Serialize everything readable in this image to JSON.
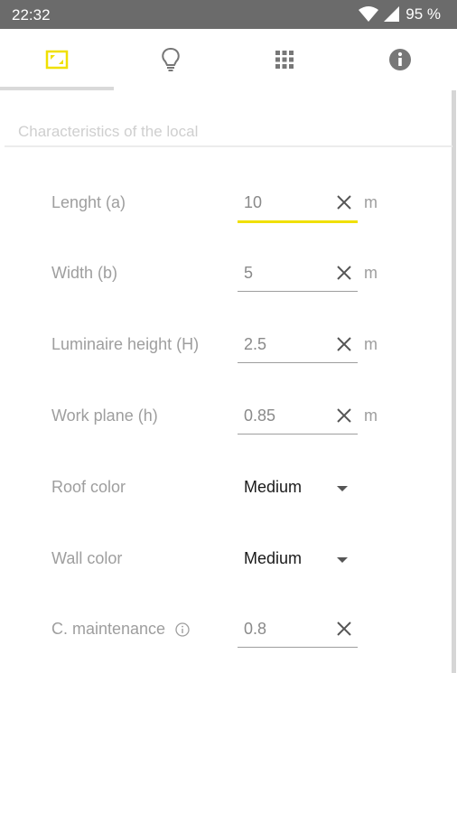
{
  "status_bar": {
    "time": "22:32",
    "battery": "95 %",
    "icons": [
      "wifi-icon",
      "signal-icon",
      "battery-icon"
    ]
  },
  "tabs": [
    {
      "name": "room",
      "icon": "room-dimensions-icon",
      "active": true
    },
    {
      "name": "luminaire",
      "icon": "lightbulb-icon",
      "active": false
    },
    {
      "name": "grid",
      "icon": "grid-icon",
      "active": false
    },
    {
      "name": "info",
      "icon": "info-icon",
      "active": false
    }
  ],
  "section": {
    "title": "Characteristics of the local"
  },
  "form": {
    "length": {
      "label": "Lenght (a)",
      "value": "10",
      "unit": "m"
    },
    "width": {
      "label": "Width (b)",
      "value": "5",
      "unit": "m"
    },
    "luminaire_height": {
      "label": "Luminaire height (H)",
      "value": "2.5",
      "unit": "m"
    },
    "work_plane": {
      "label": "Work plane (h)",
      "value": "0.85",
      "unit": "m"
    },
    "roof_color": {
      "label": "Roof color",
      "value": "Medium"
    },
    "wall_color": {
      "label": "Wall color",
      "value": "Medium"
    },
    "maintenance": {
      "label": "C. maintenance",
      "value": "0.8"
    }
  },
  "colors": {
    "accent": "#f0e000",
    "status_bar": "#6b6b6b"
  }
}
